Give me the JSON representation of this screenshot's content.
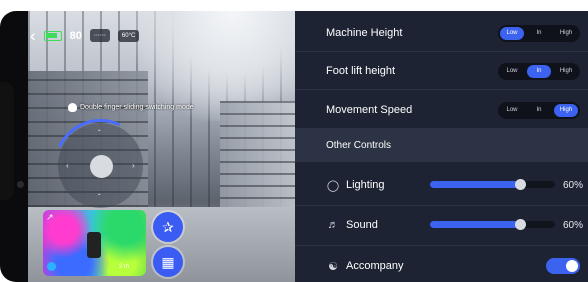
{
  "status": {
    "battery_text": "80",
    "chip_grid": "⋯⋯",
    "chip_temp": "60°C"
  },
  "gesture_hint": "Double finger sliding switching mode",
  "minimap": {
    "scale": "2 m"
  },
  "settings": {
    "machine_height": {
      "label": "Machine Height",
      "options": [
        "Low",
        "In",
        "High"
      ],
      "selected": "Low"
    },
    "foot_lift_height": {
      "label": "Foot lift height",
      "options": [
        "Low",
        "In",
        "High"
      ],
      "selected": "In"
    },
    "movement_speed": {
      "label": "Movement Speed",
      "options": [
        "Low",
        "In",
        "High"
      ],
      "selected": "High"
    },
    "other_controls": "Other Controls",
    "lighting": {
      "label": "Lighting",
      "value": 60,
      "value_text": "60%"
    },
    "sound": {
      "label": "Sound",
      "value": 60,
      "value_text": "60%"
    },
    "accompany": {
      "label": "Accompany",
      "enabled": true
    }
  },
  "icons": [
    "back-arrow-icon",
    "battery-icon",
    "hand-icon",
    "expand-icon",
    "compass-icon",
    "walk-icon",
    "menu-icon",
    "lightbulb-icon",
    "speaker-icon",
    "accompany-icon"
  ],
  "colors": {
    "accent": "#3c62f0",
    "panel_bg": "#1d2333",
    "section_bg": "#2c3344",
    "battery": "#3ddc5a"
  }
}
